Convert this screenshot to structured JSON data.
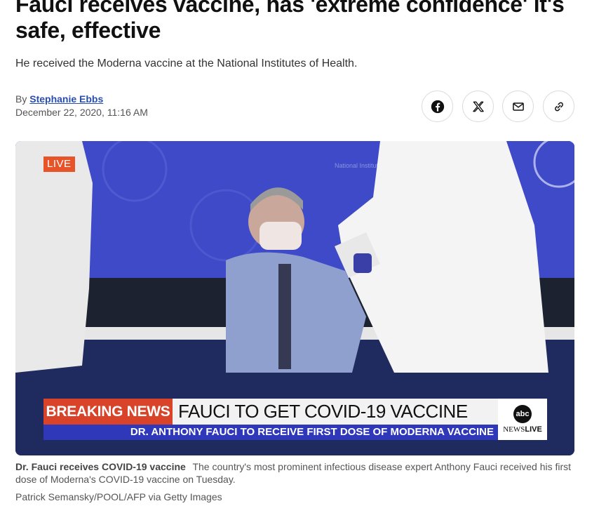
{
  "article": {
    "headline": "Fauci receives vaccine, has 'extreme confidence' it's safe, effective",
    "subheadline": "He received the Moderna vaccine at the National Institutes of Health.",
    "byline_prefix": "By",
    "author": "Stephanie Ebbs",
    "date": "December 22, 2020, 11:16 AM"
  },
  "share": {
    "icons": [
      "facebook-icon",
      "x-icon",
      "email-icon",
      "link-icon"
    ]
  },
  "video": {
    "live_label": "LIVE",
    "banner_tag": "BREAKING NEWS",
    "banner_main": "FAUCI TO GET COVID-19 VACCINE",
    "banner_sub": "DR. ANTHONY FAUCI TO RECEIVE FIRST DOSE OF MODERNA VACCINE",
    "logo_abc": "abc",
    "logo_news": "NEWS",
    "logo_live": "LIVE",
    "backdrop_text": "National Institutes of Health"
  },
  "caption": {
    "title": "Dr. Fauci receives COVID-19 vaccine",
    "text": "The country's most prominent infectious disease expert Anthony Fauci received his first dose of Moderna's COVID-19 vaccine on Tuesday.",
    "credit": "Patrick Semansky/POOL/AFP via Getty Images"
  },
  "colors": {
    "link": "#2a4db0",
    "breaking_red": "#d9432a",
    "ticker_blue": "#2f38b8",
    "backdrop_blue": "#3d49c9"
  }
}
